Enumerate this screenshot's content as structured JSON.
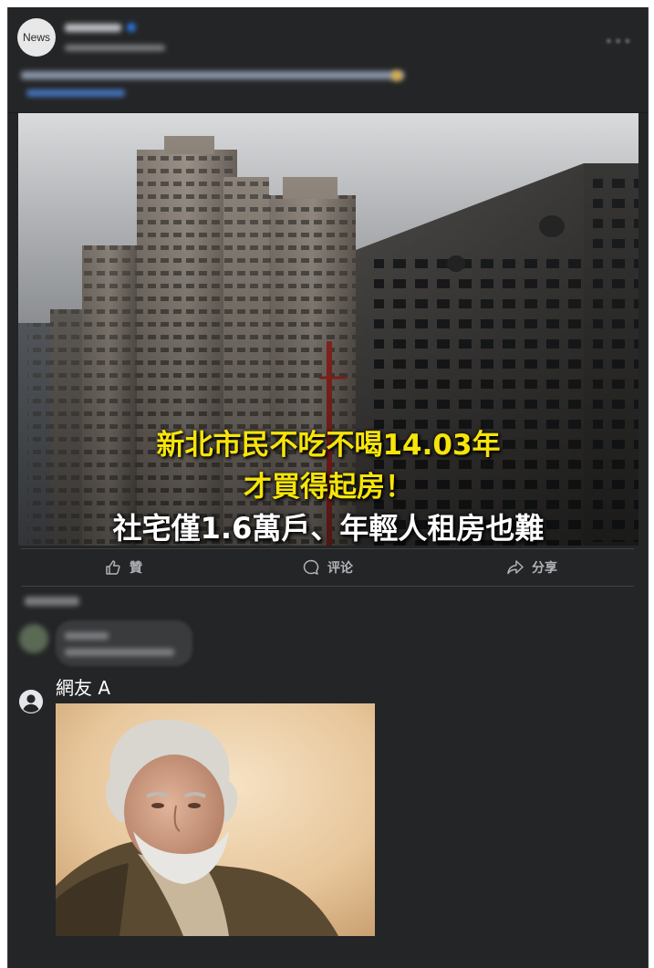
{
  "post": {
    "page_avatar_label": "News",
    "more_icon": "more-horizontal-icon",
    "image_captions": {
      "line1": "新北市民不吃不喝14.03年",
      "line2": "才買得起房！",
      "line3": "社宅僅1.6萬戶、年輕人租房也難"
    }
  },
  "actions": {
    "like_label": "贊",
    "comment_label": "评论",
    "share_label": "分享"
  },
  "comment": {
    "username": "網友 A"
  },
  "colors": {
    "background": "#242526",
    "caption_yellow": "#f7e40a",
    "action_text": "#b0b3b8"
  }
}
